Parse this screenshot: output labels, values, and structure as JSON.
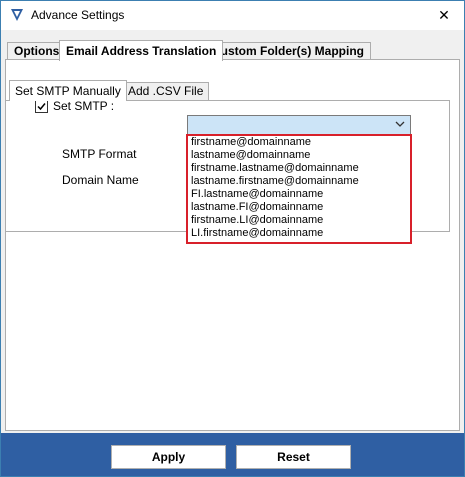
{
  "window": {
    "title": "Advance Settings"
  },
  "tabs": [
    "Options",
    "Email Address Translation",
    "Custom Folder(s) Mapping"
  ],
  "inner_tabs": [
    "Set SMTP Manually",
    "Add .CSV File"
  ],
  "smtp": {
    "checkbox_label": "Set SMTP :",
    "format_label": "SMTP Format",
    "domain_label": "Domain Name",
    "format_value": ""
  },
  "dropdown_options": [
    "firstname@domainname",
    "lastname@domainname",
    "firstname.lastname@domainname",
    "lastname.firstname@domainname",
    "FI.lastname@domainname",
    "lastname.FI@domainname",
    "firstname.LI@domainname",
    "LI.firstname@domainname"
  ],
  "buttons": {
    "apply": "Apply",
    "reset": "Reset"
  },
  "colors": {
    "footer": "#2f5fa3",
    "highlight": "#d8202a",
    "combo": "#cce4f7"
  }
}
